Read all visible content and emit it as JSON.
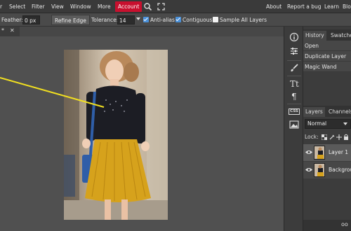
{
  "menu": {
    "items": [
      {
        "label": "r"
      },
      {
        "label": "Select"
      },
      {
        "label": "Filter"
      },
      {
        "label": "View"
      },
      {
        "label": "Window"
      },
      {
        "label": "More"
      },
      {
        "label": "Account"
      }
    ],
    "right_items": [
      {
        "label": "About"
      },
      {
        "label": "Report a bug"
      },
      {
        "label": "Learn"
      },
      {
        "label": "Blo"
      }
    ]
  },
  "options": {
    "feather_label": "Feather:",
    "feather_value": "0 px",
    "refine_edge_label": "Refine Edge",
    "tolerance_label": "Tolerance:",
    "tolerance_value": "14",
    "antialias_label": "Anti-alias",
    "antialias_checked": true,
    "contiguous_label": "Contiguous",
    "contiguous_checked": true,
    "sample_all_label": "Sample All Layers",
    "sample_all_checked": false
  },
  "doc_tab": {
    "modified_mark": "*",
    "close_glyph": "✕"
  },
  "history_panel": {
    "tabs": [
      {
        "label": "History"
      },
      {
        "label": "Swatche"
      }
    ],
    "items": [
      {
        "label": "Open"
      },
      {
        "label": "Duplicate Layer"
      },
      {
        "label": "Magic Wand"
      }
    ]
  },
  "layers_panel": {
    "tabs": [
      {
        "label": "Layers"
      },
      {
        "label": "Channels"
      }
    ],
    "blend_mode": "Normal",
    "lock_label": "Lock:",
    "layers": [
      {
        "name": "Layer 1",
        "selected": true
      },
      {
        "name": "Backgrou",
        "selected": false
      }
    ],
    "footer_glyph": "oo"
  },
  "toolstrip": {
    "icons": [
      "info-icon",
      "sliders-icon",
      "brush-icon",
      "text-type-icon",
      "paragraph-icon",
      "css-icon",
      "image-icon"
    ],
    "css_label": "CSS"
  },
  "colors": {
    "accent_account": "#c8102e",
    "checkbox_on": "#4a90d9",
    "selection_line": "#f2e020"
  }
}
